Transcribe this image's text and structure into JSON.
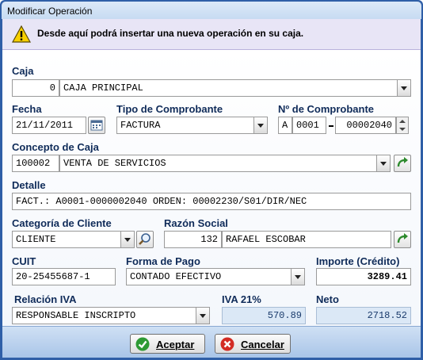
{
  "window": {
    "title": "Modificar Operación"
  },
  "banner": {
    "message": "Desde aquí podrá insertar una nueva operación en su caja."
  },
  "caja": {
    "label": "Caja",
    "code": "0",
    "name": "CAJA PRINCIPAL"
  },
  "fecha": {
    "label": "Fecha",
    "value": "21/11/2011"
  },
  "tipo_comprobante": {
    "label": "Tipo de Comprobante",
    "value": "FACTURA"
  },
  "nro_comprobante": {
    "label": "Nº de Comprobante",
    "letra": "A",
    "punto": "0001",
    "numero": "00002040"
  },
  "concepto": {
    "label": "Concepto de Caja",
    "code": "100002",
    "name": "VENTA DE SERVICIOS"
  },
  "detalle": {
    "label": "Detalle",
    "value": "FACT.: A0001-0000002040 ORDEN: 00002230/S01/DIR/NEC"
  },
  "categoria": {
    "label": "Categoría de Cliente",
    "value": "CLIENTE"
  },
  "razon_social": {
    "label": "Razón Social",
    "code": "132",
    "name": "RAFAEL ESCOBAR"
  },
  "cuit": {
    "label": "CUIT",
    "value": "20-25455687-1"
  },
  "forma_pago": {
    "label": "Forma de Pago",
    "value": "CONTADO EFECTIVO"
  },
  "importe": {
    "label": "Importe (Crédito)",
    "value": "3289.41"
  },
  "relacion_iva": {
    "label": "Relación IVA",
    "value": "RESPONSABLE INSCRIPTO"
  },
  "iva": {
    "label": "IVA 21%",
    "value": "570.89"
  },
  "neto": {
    "label": "Neto",
    "value": "2718.52"
  },
  "buttons": {
    "accept": "Aceptar",
    "cancel": "Cancelar"
  },
  "icons": {
    "warning": "warning-icon",
    "calendar": "calendar-icon",
    "refresh": "refresh-icon",
    "search": "search-icon",
    "accept": "check-icon",
    "cancel": "cancel-icon"
  },
  "colors": {
    "label": "#0f2b59",
    "banner": "#e8e5f6",
    "readonly_field": "#dbe8f6",
    "accept_icon": "#2e9a34",
    "cancel_icon": "#d32b23"
  }
}
